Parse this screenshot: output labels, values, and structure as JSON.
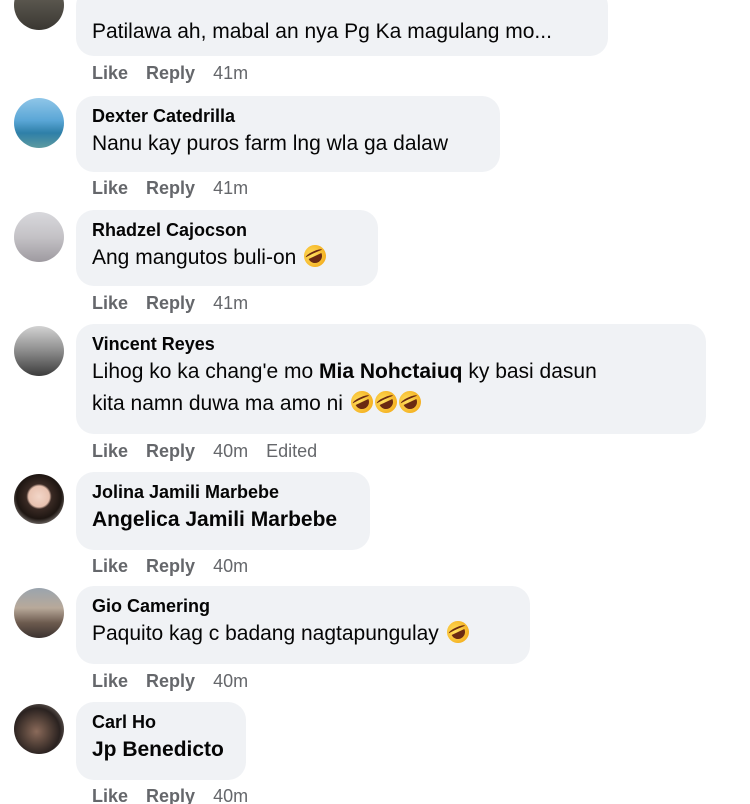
{
  "comments": [
    {
      "author": "",
      "text": "Patilawa ah, mabal an nya Pg Ka magulang mo...",
      "like": "Like",
      "reply": "Reply",
      "time": "41m"
    },
    {
      "author": "Dexter Catedrilla",
      "text": "Nanu kay puros farm lng wla ga dalaw",
      "like": "Like",
      "reply": "Reply",
      "time": "41m"
    },
    {
      "author": "Rhadzel Cajocson",
      "text": "Ang mangutos buli-on",
      "like": "Like",
      "reply": "Reply",
      "time": "41m"
    },
    {
      "author": "Vincent Reyes",
      "text_before": "Lihog ko ka chang'e mo",
      "mention": "Mia Nohctaiuq",
      "text_after": "ky basi dasun",
      "text_line2": "kita namn duwa ma amo ni",
      "like": "Like",
      "reply": "Reply",
      "time": "40m",
      "edited": "Edited"
    },
    {
      "author": "Jolina Jamili Marbebe",
      "mention": "Angelica Jamili Marbebe",
      "like": "Like",
      "reply": "Reply",
      "time": "40m"
    },
    {
      "author": "Gio Camering",
      "text": "Paquito kag c badang nagtapungulay",
      "like": "Like",
      "reply": "Reply",
      "time": "40m"
    },
    {
      "author": "Carl Ho",
      "mention": "Jp Benedicto",
      "like": "Like",
      "reply": "Reply",
      "time": "40m"
    }
  ],
  "colors": {
    "bubble": "#f0f2f5",
    "text": "#050505",
    "meta": "#65676b"
  },
  "icons": {
    "reaction_emoji": "rolling-on-floor-laughing-emoji"
  }
}
